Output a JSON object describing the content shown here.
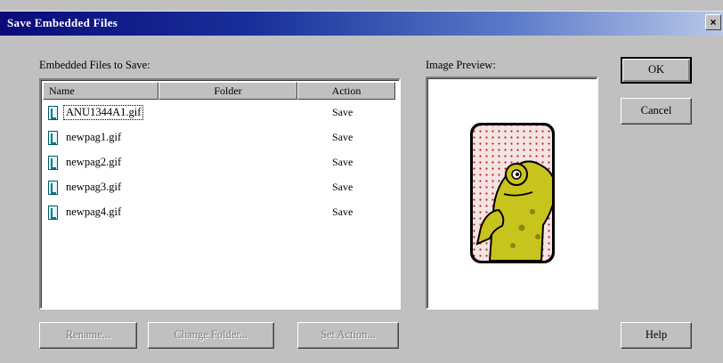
{
  "window": {
    "title": "Save Embedded Files",
    "close_glyph": "×"
  },
  "files_section": {
    "label": "Embedded Files to Save:",
    "columns": {
      "name": "Name",
      "folder": "Folder",
      "action": "Action"
    },
    "rows": [
      {
        "name": "ANU1344A1.gif",
        "folder": "",
        "action": "Save",
        "selected": true
      },
      {
        "name": "newpag1.gif",
        "folder": "",
        "action": "Save"
      },
      {
        "name": "newpag2.gif",
        "folder": "",
        "action": "Save"
      },
      {
        "name": "newpag3.gif",
        "folder": "",
        "action": "Save"
      },
      {
        "name": "newpag4.gif",
        "folder": "",
        "action": "Save"
      }
    ]
  },
  "preview_section": {
    "label": "Image Preview:"
  },
  "buttons": {
    "ok": "OK",
    "cancel": "Cancel",
    "help": "Help",
    "rename": "Rename...",
    "change_folder": "Change Folder...",
    "set_action": "Set Action..."
  },
  "colors": {
    "title_gradient_start": "#0a0a7a",
    "title_gradient_end": "#b8c8e8",
    "dialog_face": "#c0c0c0",
    "frog_fill": "#c8c41e",
    "card_dots": "#c02020"
  }
}
